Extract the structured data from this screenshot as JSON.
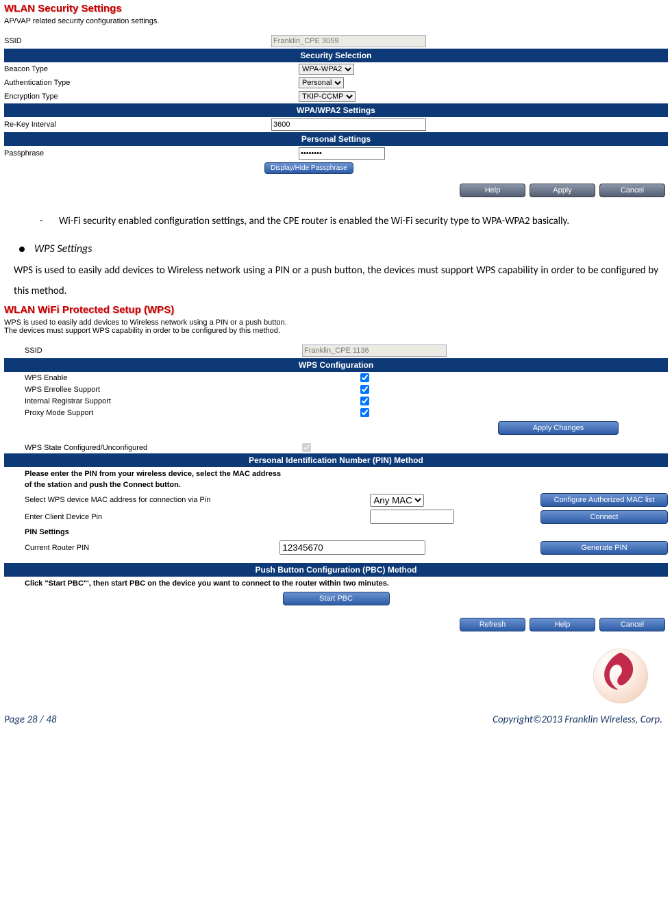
{
  "sec1": {
    "title": "WLAN Security Settings",
    "desc": "AP/VAP related security configuration settings.",
    "ssid_label": "SSID",
    "ssid_value": "Franklin_CPE 3059",
    "bar_security": "Security Selection",
    "beacon_label": "Beacon Type",
    "beacon_value": "WPA-WPA2",
    "auth_label": "Authentication Type",
    "auth_value": "Personal",
    "enc_label": "Encryption Type",
    "enc_value": "TKIP-CCMP",
    "bar_wpa": "WPA/WPA2 Settings",
    "rekey_label": "Re-Key Interval",
    "rekey_value": "3600",
    "bar_personal": "Personal Settings",
    "pass_label": "Passphrase",
    "pass_value": "••••••••",
    "btn_display": "Display/Hide Passphrase",
    "btn_help": "Help",
    "btn_apply": "Apply",
    "btn_cancel": "Cancel"
  },
  "doc": {
    "dash1": "Wi-Fi security enabled configuration settings, and the CPE router is enabled the Wi-Fi security type to WPA-WPA2 basically.",
    "wps_heading": "WPS Settings",
    "wps_para": "WPS is used to easily add devices to Wireless network using a PIN or a push button, the devices must support WPS capability in order to be configured by this method."
  },
  "sec2": {
    "title": "WLAN WiFi Protected Setup (WPS)",
    "desc1": "WPS is used to easily add devices to Wireless network using a PIN or a push button.",
    "desc2": "The devices must support WPS capability in order to be configured by this method.",
    "ssid_label": "SSID",
    "ssid_value": "Franklin_CPE 1136",
    "bar_wpsconf": "WPS Configuration",
    "wps_enable": "WPS Enable",
    "wps_enrollee": "WPS Enrollee Support",
    "wps_registrar": "Internal Registrar Support",
    "wps_proxy": "Proxy Mode Support",
    "btn_applychg": "Apply Changes",
    "wps_state": "WPS State Configured/Unconfigured",
    "bar_pin": "Personal Identification Number (PIN) Method",
    "pin_instr1": "Please enter the PIN from your wireless device, select the MAC address",
    "pin_instr2": "of the station and push the Connect button.",
    "mac_label": "Select WPS device MAC address for connection via Pin",
    "mac_value": "Any MAC",
    "btn_configmac": "Configure Authorized MAC list",
    "client_label": "Enter Client Device Pin",
    "btn_connect": "Connect",
    "pinsettings": "PIN Settings",
    "routerpin_label": "Current Router PIN",
    "routerpin_value": "12345670",
    "btn_genpin": "Generate PIN",
    "bar_pbc": "Push Button Configuration (PBC) Method",
    "pbc_instr": "Click \"Start PBC\"', then start PBC on the device you want to connect to the router within two minutes.",
    "btn_startpbc": "Start PBC",
    "btn_refresh": "Refresh",
    "btn_help": "Help",
    "btn_cancel": "Cancel"
  },
  "footer": {
    "page": "Page  28  /  48",
    "copy": "Copyright©2013  Franklin  Wireless, Corp."
  }
}
